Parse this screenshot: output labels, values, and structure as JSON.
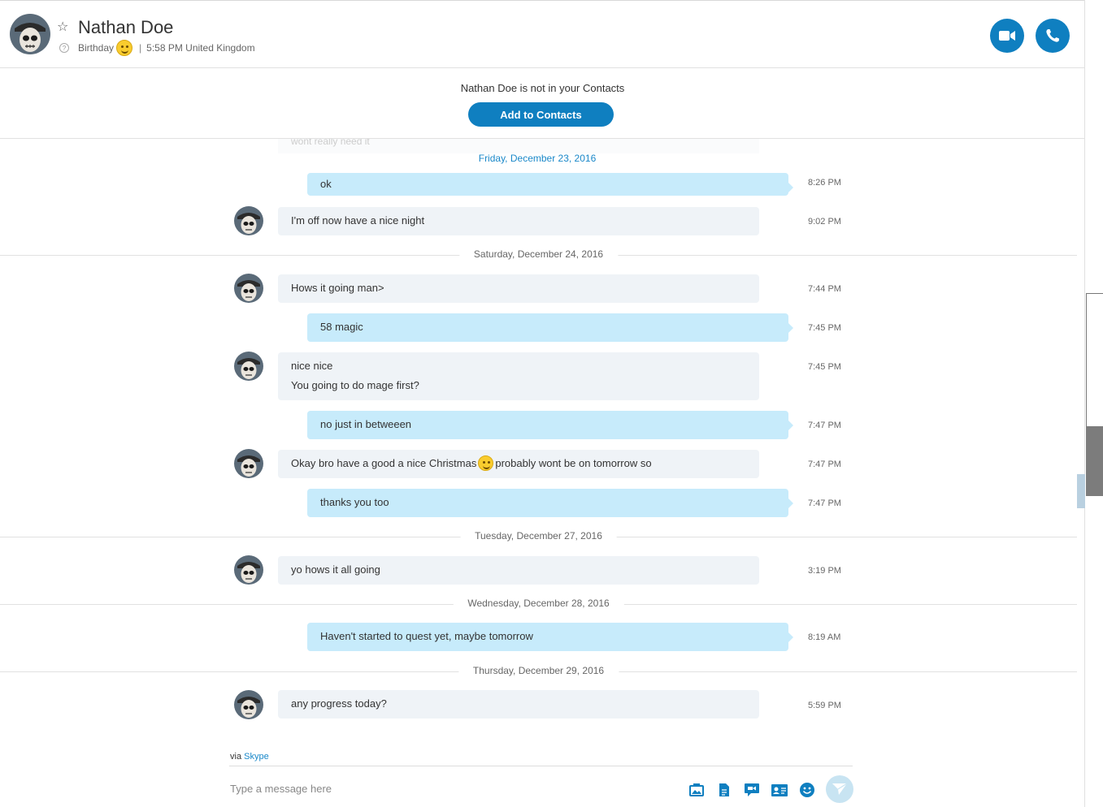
{
  "header": {
    "name": "Nathan Doe",
    "mood": "Birthday",
    "separator": "|",
    "local_time": "5:58 PM United Kingdom",
    "icons": {
      "favorite": "star-icon",
      "help": "help-icon",
      "video": "video-call-icon",
      "audio": "phone-icon"
    }
  },
  "notice": {
    "text": "Nathan Doe is not in your Contacts",
    "button": "Add to Contacts"
  },
  "conversation": {
    "faded_text": "wont really need it",
    "first_date": "Friday, December 23, 2016",
    "dates": [
      "Saturday, December 24, 2016",
      "Tuesday, December 27, 2016",
      "Wednesday, December 28, 2016",
      "Thursday, December 29, 2016"
    ],
    "messages": [
      {
        "direction": "out",
        "text": "ok",
        "time": "8:26 PM"
      },
      {
        "direction": "in",
        "text": "I'm off now have a nice night",
        "time": "9:02 PM"
      },
      {
        "direction": "in",
        "text": "Hows it going man>",
        "time": "7:44 PM"
      },
      {
        "direction": "out",
        "text": "58 magic",
        "time": "7:45 PM"
      },
      {
        "direction": "in",
        "text": "nice nice",
        "text2": "You going to do mage first?",
        "time": "7:45 PM"
      },
      {
        "direction": "out",
        "text": "no just in betweeen",
        "time": "7:47 PM"
      },
      {
        "direction": "in",
        "text": "Okay bro have a good a nice Christmas",
        "text2": "probably wont be on tomorrow so",
        "time": "7:47 PM"
      },
      {
        "direction": "out",
        "text": "thanks you too",
        "time": "7:47 PM"
      },
      {
        "direction": "in",
        "text": "yo hows it all going",
        "time": "3:19 PM"
      },
      {
        "direction": "out",
        "text": "Haven't started to quest yet, maybe tomorrow",
        "time": "8:19 AM"
      },
      {
        "direction": "in",
        "text": "any progress today?",
        "time": "5:59 PM"
      }
    ]
  },
  "footer": {
    "via_label": "via",
    "via_link": "Skype",
    "placeholder": "Type a message here",
    "tools": [
      "image-icon",
      "file-icon",
      "video-message-icon",
      "contact-card-icon",
      "emoticon-icon",
      "send-icon"
    ]
  },
  "colors": {
    "accent": "#0f7fc0",
    "outgoing_bubble": "#c7ebfb",
    "incoming_bubble": "#eff3f7",
    "date_blue": "#1a88c9"
  }
}
